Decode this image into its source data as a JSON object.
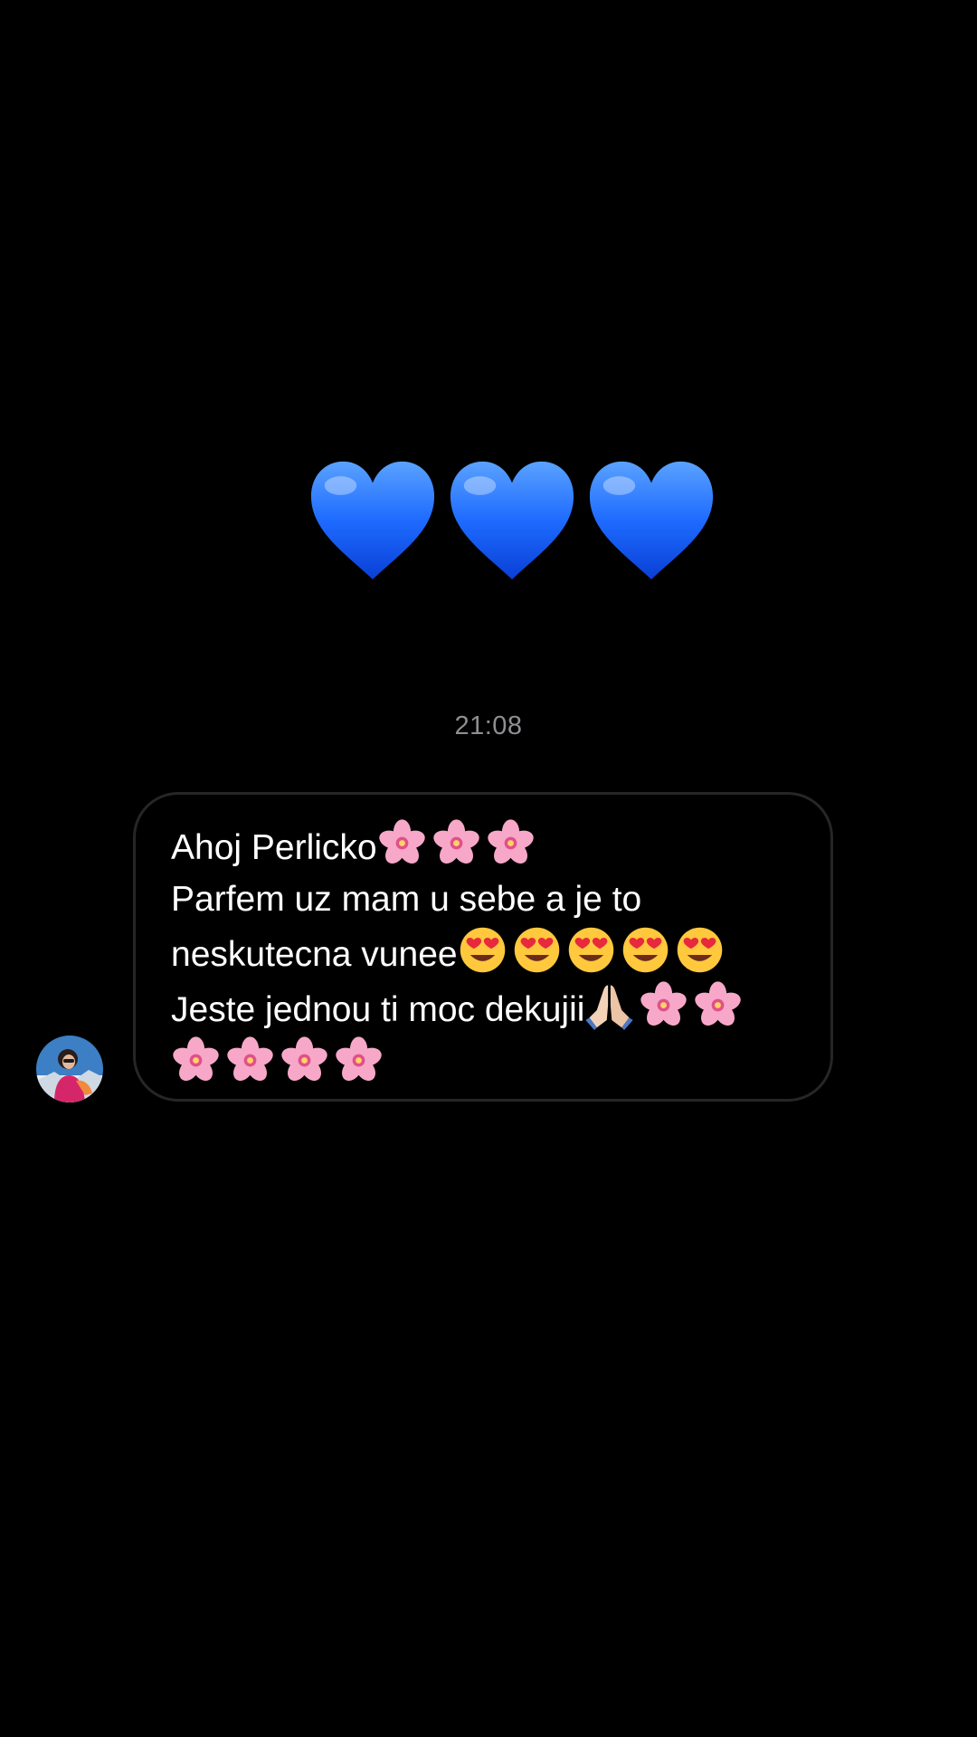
{
  "conversation": {
    "reaction_emoji": [
      "blue-heart",
      "blue-heart",
      "blue-heart"
    ],
    "timestamp": "21:08",
    "message": {
      "lines": [
        {
          "text": "Ahoj Perlicko",
          "emoji": [
            "cherry-blossom",
            "cherry-blossom",
            "cherry-blossom"
          ]
        },
        {
          "text": "Parfem uz mam u sebe a je to",
          "emoji": []
        },
        {
          "text": "neskutecna vunee",
          "emoji": [
            "heart-eyes",
            "heart-eyes",
            "heart-eyes",
            "heart-eyes",
            "heart-eyes"
          ]
        },
        {
          "text": "Jeste jednou ti moc dekujii",
          "emoji": [
            "folded-hands",
            "cherry-blossom",
            "cherry-blossom"
          ]
        },
        {
          "text": "",
          "emoji": [
            "cherry-blossom",
            "cherry-blossom",
            "cherry-blossom",
            "cherry-blossom"
          ]
        }
      ]
    },
    "sender_avatar": "profile-photo"
  },
  "colors": {
    "background": "#000000",
    "bubble_border": "#262626",
    "timestamp": "#8e8e93",
    "heart_blue": "#1e6bff"
  }
}
